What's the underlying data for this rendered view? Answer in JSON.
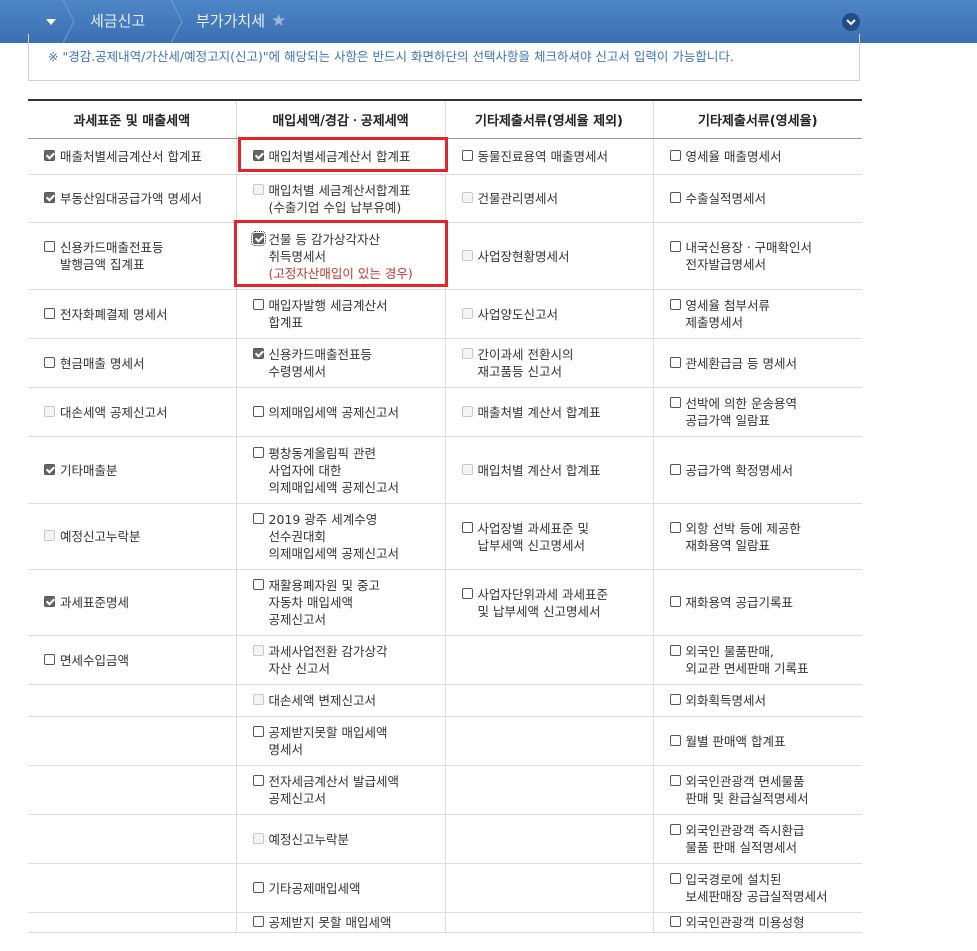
{
  "nav": {
    "crumbs": [
      "세금신고",
      "부가가치세"
    ]
  },
  "notice": "※ \"경감.공제내역/가산세/예정고지(신고)\"에 해당되는 사항은 반드시 화면하단의 선택사항을 체크하셔야 신고서 입력이 가능합니다.",
  "headers": [
    "과세표준 및 매출세액",
    "매입세액/경감ㆍ공제세액",
    "기타제출서류(영세율 제외)",
    "기타제출서류(영세율)"
  ],
  "rows": [
    [
      {
        "label": "매출처별세금계산서 합계표",
        "state": "checked"
      },
      {
        "label": "매입처별세금계산서 합계표",
        "state": "checked"
      },
      {
        "label": "동물진료용역 매출명세서",
        "state": "unchecked"
      },
      {
        "label": "영세율 매출명세서",
        "state": "unchecked"
      }
    ],
    [
      {
        "label": "부동산임대공급가액 명세서",
        "state": "checked"
      },
      {
        "label": "매입처별 세금계산서합계표\n(수출기업 수입 납부유예)",
        "state": "disabled"
      },
      {
        "label": "건물관리명세서",
        "state": "disabled"
      },
      {
        "label": "수출실적명세서",
        "state": "unchecked"
      }
    ],
    [
      {
        "label": "신용카드매출전표등\n발행금액 집계표",
        "state": "unchecked"
      },
      {
        "label": "건물 등 감가상각자산\n취득명세서",
        "note": "(고정자산매입이 있는 경우)",
        "state": "checked-focus"
      },
      {
        "label": "사업장현황명세서",
        "state": "disabled"
      },
      {
        "label": "내국신용장ㆍ구매확인서\n전자발급명세서",
        "state": "unchecked"
      }
    ],
    [
      {
        "label": "전자화폐결제 명세서",
        "state": "unchecked"
      },
      {
        "label": "매입자발행 세금계산서\n합계표",
        "state": "unchecked"
      },
      {
        "label": "사업양도신고서",
        "state": "disabled"
      },
      {
        "label": "영세율 첨부서류\n 제출명세서",
        "state": "unchecked"
      }
    ],
    [
      {
        "label": "현금매출 명세서",
        "state": "unchecked"
      },
      {
        "label": "신용카드매출전표등\n수령명세서",
        "state": "checked"
      },
      {
        "label": "간이과세 전환시의\n재고품등 신고서",
        "state": "disabled"
      },
      {
        "label": "관세환급금 등 명세서",
        "state": "unchecked"
      }
    ],
    [
      {
        "label": "대손세액 공제신고서",
        "state": "disabled"
      },
      {
        "label": "의제매입세액 공제신고서",
        "state": "unchecked"
      },
      {
        "label": "매출처별 계산서 합계표",
        "state": "disabled"
      },
      {
        "label": "선박에 의한 운송용역\n공급가액 일람표",
        "state": "unchecked"
      }
    ],
    [
      {
        "label": "기타매출분",
        "state": "checked"
      },
      {
        "label": "평창동계올림픽 관련\n사업자에 대한\n의제매입세액 공제신고서",
        "state": "unchecked"
      },
      {
        "label": "매입처별 계산서 합계표",
        "state": "disabled"
      },
      {
        "label": "공급가액 확정명세서",
        "state": "unchecked"
      }
    ],
    [
      {
        "label": "예정신고누락분",
        "state": "disabled"
      },
      {
        "label": "2019 광주 세계수영\n선수권대회\n의제매입세액 공제신고서",
        "state": "unchecked"
      },
      {
        "label": "사업장별 과세표준 및\n납부세액 신고명세서",
        "state": "unchecked"
      },
      {
        "label": "외항 선박 등에 제공한\n재화용역 일람표",
        "state": "unchecked"
      }
    ],
    [
      {
        "label": "과세표준명세",
        "state": "checked"
      },
      {
        "label": "재활용폐자원 및 중고\n자동차 매입세액\n공제신고서",
        "state": "unchecked"
      },
      {
        "label": "사업자단위과세 과세표준\n및 납부세액 신고명세서",
        "state": "unchecked"
      },
      {
        "label": "재화용역 공급기록표",
        "state": "unchecked"
      }
    ],
    [
      {
        "label": "면세수입금액",
        "state": "unchecked"
      },
      {
        "label": "과세사업전환 감가상각\n자산 신고서",
        "state": "disabled"
      },
      null,
      {
        "label": "외국인 물품판매,\n외교관 면세판매 기록표",
        "state": "unchecked"
      }
    ],
    [
      null,
      {
        "label": "대손세액 변제신고서",
        "state": "disabled"
      },
      null,
      {
        "label": "외화획득명세서",
        "state": "unchecked"
      }
    ],
    [
      null,
      {
        "label": "공제받지못할 매입세액\n명세서",
        "state": "unchecked"
      },
      null,
      {
        "label": "월별 판매액 합계표",
        "state": "unchecked"
      }
    ],
    [
      null,
      {
        "label": "전자세금계산서 발급세액\n공제신고서",
        "state": "unchecked"
      },
      null,
      {
        "label": "외국인관광객 면세물품\n판매 및 환급실적명세서",
        "state": "unchecked"
      }
    ],
    [
      null,
      {
        "label": "예정신고누락분",
        "state": "disabled"
      },
      null,
      {
        "label": "외국인관광객 즉시환급\n물품 판매 실적명세서",
        "state": "unchecked"
      }
    ],
    [
      null,
      {
        "label": "기타공제매입세액",
        "state": "unchecked"
      },
      null,
      {
        "label": "입국경로에 설치된\n보세판매장 공급실적명세서",
        "state": "unchecked"
      }
    ],
    [
      null,
      {
        "label": "공제받지 못할 매입세액",
        "state": "unchecked"
      },
      null,
      {
        "label": "외국인관광객 미용성형",
        "state": "unchecked"
      }
    ]
  ]
}
